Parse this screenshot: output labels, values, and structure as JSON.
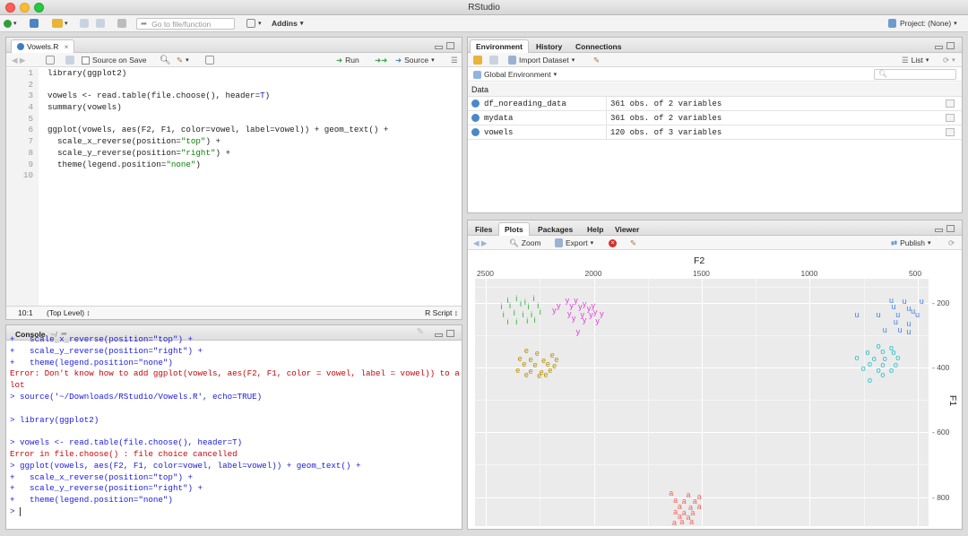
{
  "window": {
    "title": "RStudio"
  },
  "toolbar": {
    "goto_placeholder": "Go to file/function",
    "addins": "Addins",
    "project": "Project: (None)"
  },
  "source": {
    "tab": "Vowels.R",
    "source_on_save": "Source on Save",
    "run": "Run",
    "source_btn": "Source",
    "lines": [
      {
        "n": "1",
        "segs": [
          {
            "t": "library(ggplot2)",
            "c": ""
          }
        ]
      },
      {
        "n": "2",
        "segs": []
      },
      {
        "n": "3",
        "segs": [
          {
            "t": "vowels <- read.table(file.choose(), header=",
            "c": ""
          },
          {
            "t": "T",
            "c": "blue"
          },
          {
            "t": ")",
            "c": ""
          }
        ]
      },
      {
        "n": "4",
        "segs": [
          {
            "t": "summary(vowels)",
            "c": ""
          }
        ]
      },
      {
        "n": "5",
        "segs": []
      },
      {
        "n": "6",
        "segs": [
          {
            "t": "ggplot(vowels, aes(F2, F1, color=vowel, label=vowel)) + geom_text() +",
            "c": ""
          }
        ]
      },
      {
        "n": "7",
        "segs": [
          {
            "t": "  scale_x_reverse(position=",
            "c": ""
          },
          {
            "t": "\"top\"",
            "c": "grn"
          },
          {
            "t": ") +",
            "c": ""
          }
        ]
      },
      {
        "n": "8",
        "segs": [
          {
            "t": "  scale_y_reverse(position=",
            "c": ""
          },
          {
            "t": "\"right\"",
            "c": "grn"
          },
          {
            "t": ") +",
            "c": ""
          }
        ]
      },
      {
        "n": "9",
        "segs": [
          {
            "t": "  theme(legend.position=",
            "c": ""
          },
          {
            "t": "\"none\"",
            "c": "grn"
          },
          {
            "t": ")",
            "c": ""
          }
        ]
      },
      {
        "n": "10",
        "segs": []
      }
    ],
    "status_pos": "10:1",
    "status_scope": "(Top Level) ↕",
    "status_lang": "R Script ↕"
  },
  "console": {
    "title": "Console",
    "path": "~/",
    "lines": [
      {
        "t": "+   scale_x_reverse(position=\"top\") +",
        "c": "blue"
      },
      {
        "t": "+   scale_y_reverse(position=\"right\") +",
        "c": "blue"
      },
      {
        "t": "+   theme(legend.position=\"none\")",
        "c": "blue"
      },
      {
        "t": "Error: Don't know how to add ggplot(vowels, aes(F2, F1, color = vowel, label = vowel)) to a p",
        "c": "red"
      },
      {
        "t": "lot",
        "c": "red"
      },
      {
        "t": "> source('~/Downloads/RStudio/Vowels.R', echo=TRUE)",
        "c": "blue"
      },
      {
        "t": "",
        "c": ""
      },
      {
        "t": "> library(ggplot2)",
        "c": "blue"
      },
      {
        "t": "",
        "c": ""
      },
      {
        "t": "> vowels <- read.table(file.choose(), header=T)",
        "c": "blue"
      },
      {
        "t": "Error in file.choose() : file choice cancelled",
        "c": "red"
      },
      {
        "t": "> ggplot(vowels, aes(F2, F1, color=vowel, label=vowel)) + geom_text() +",
        "c": "blue"
      },
      {
        "t": "+   scale_x_reverse(position=\"top\") +",
        "c": "blue"
      },
      {
        "t": "+   scale_y_reverse(position=\"right\") +",
        "c": "blue"
      },
      {
        "t": "+   theme(legend.position=\"none\")",
        "c": "blue"
      },
      {
        "t": "> ",
        "c": "blue"
      }
    ]
  },
  "env": {
    "tabs": [
      "Environment",
      "History",
      "Connections"
    ],
    "import": "Import Dataset",
    "list": "List",
    "global": "Global Environment",
    "section": "Data",
    "rows": [
      {
        "name": "df_noreading_data",
        "value": "361 obs. of 2 variables"
      },
      {
        "name": "mydata",
        "value": "361 obs. of 2 variables"
      },
      {
        "name": "vowels",
        "value": "120 obs. of 3 variables"
      }
    ]
  },
  "files": {
    "tabs": [
      "Files",
      "Plots",
      "Packages",
      "Help",
      "Viewer"
    ],
    "zoom": "Zoom",
    "export": "Export",
    "publish": "Publish"
  },
  "chart_data": {
    "type": "scatter",
    "xlabel": "F2",
    "ylabel": "F1",
    "x_ticks": [
      2500,
      2000,
      1500,
      1000,
      500
    ],
    "y_ticks": [
      200,
      400,
      600,
      800
    ],
    "xlim": [
      2550,
      450
    ],
    "ylim": [
      125,
      890
    ],
    "x_reversed": true,
    "y_reversed": true,
    "x_axis_position": "top",
    "y_axis_position": "right",
    "legend": "none",
    "series": [
      {
        "name": "i",
        "color": "#1fae2b",
        "points": [
          [
            2390,
            195
          ],
          [
            2350,
            190
          ],
          [
            2310,
            200
          ],
          [
            2270,
            190
          ],
          [
            2420,
            215
          ],
          [
            2380,
            212
          ],
          [
            2330,
            205
          ],
          [
            2295,
            215
          ],
          [
            2250,
            210
          ],
          [
            2410,
            240
          ],
          [
            2360,
            232
          ],
          [
            2320,
            238
          ],
          [
            2280,
            240
          ],
          [
            2240,
            230
          ],
          [
            2390,
            260
          ],
          [
            2350,
            262
          ],
          [
            2300,
            258
          ],
          [
            2265,
            255
          ]
        ]
      },
      {
        "name": "y",
        "color": "#e33ddb",
        "points": [
          [
            2120,
            195
          ],
          [
            2080,
            195
          ],
          [
            2040,
            205
          ],
          [
            2000,
            210
          ],
          [
            2160,
            210
          ],
          [
            2100,
            212
          ],
          [
            2060,
            215
          ],
          [
            2020,
            220
          ],
          [
            1990,
            230
          ],
          [
            2180,
            225
          ],
          [
            2110,
            235
          ],
          [
            2050,
            238
          ],
          [
            2010,
            240
          ],
          [
            1960,
            235
          ],
          [
            2090,
            250
          ],
          [
            2040,
            255
          ],
          [
            1980,
            258
          ],
          [
            2070,
            290
          ]
        ]
      },
      {
        "name": "e",
        "color": "#b58f00",
        "points": [
          [
            2310,
            350
          ],
          [
            2260,
            358
          ],
          [
            2190,
            362
          ],
          [
            2340,
            375
          ],
          [
            2290,
            378
          ],
          [
            2230,
            380
          ],
          [
            2170,
            378
          ],
          [
            2320,
            392
          ],
          [
            2270,
            395
          ],
          [
            2210,
            390
          ],
          [
            2180,
            398
          ],
          [
            2350,
            410
          ],
          [
            2290,
            412
          ],
          [
            2240,
            415
          ],
          [
            2200,
            410
          ],
          [
            2310,
            425
          ],
          [
            2250,
            428
          ],
          [
            2220,
            425
          ]
        ]
      },
      {
        "name": "a",
        "color": "#f0645c",
        "points": [
          [
            1640,
            790
          ],
          [
            1560,
            795
          ],
          [
            1510,
            800
          ],
          [
            1620,
            812
          ],
          [
            1580,
            815
          ],
          [
            1530,
            815
          ],
          [
            1600,
            832
          ],
          [
            1550,
            835
          ],
          [
            1510,
            832
          ],
          [
            1620,
            848
          ],
          [
            1580,
            850
          ],
          [
            1540,
            850
          ],
          [
            1600,
            862
          ],
          [
            1560,
            866
          ],
          [
            1625,
            882
          ],
          [
            1590,
            880
          ],
          [
            1545,
            878
          ]
        ]
      },
      {
        "name": "u",
        "color": "#3e7fe8",
        "points": [
          [
            620,
            195
          ],
          [
            560,
            198
          ],
          [
            480,
            198
          ],
          [
            610,
            215
          ],
          [
            540,
            220
          ],
          [
            520,
            228
          ],
          [
            780,
            240
          ],
          [
            680,
            240
          ],
          [
            590,
            240
          ],
          [
            500,
            240
          ],
          [
            600,
            262
          ],
          [
            540,
            265
          ],
          [
            650,
            285
          ],
          [
            580,
            285
          ],
          [
            540,
            290
          ]
        ]
      },
      {
        "name": "o",
        "color": "#1bbcc7",
        "points": [
          [
            680,
            335
          ],
          [
            620,
            340
          ],
          [
            730,
            355
          ],
          [
            660,
            352
          ],
          [
            610,
            355
          ],
          [
            780,
            372
          ],
          [
            700,
            375
          ],
          [
            650,
            375
          ],
          [
            590,
            372
          ],
          [
            720,
            390
          ],
          [
            660,
            395
          ],
          [
            600,
            395
          ],
          [
            750,
            405
          ],
          [
            680,
            410
          ],
          [
            620,
            410
          ],
          [
            660,
            425
          ],
          [
            720,
            440
          ]
        ]
      }
    ]
  }
}
